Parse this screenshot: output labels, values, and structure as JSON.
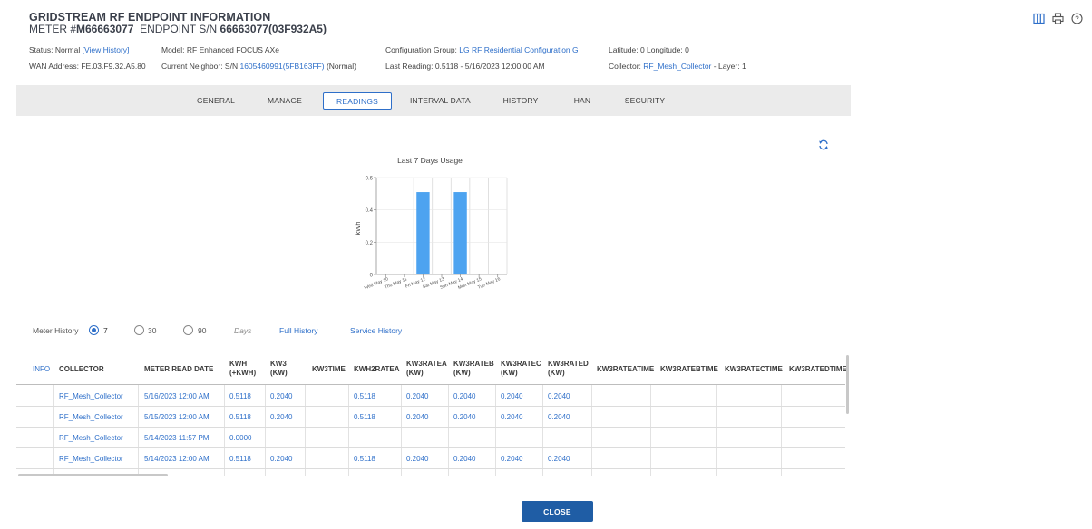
{
  "header": {
    "title": "GRIDSTREAM RF ENDPOINT INFORMATION",
    "meter_prefix": "METER #",
    "meter_number": "M66663077",
    "endpoint_prefix": "ENDPOINT S/N",
    "endpoint_sn": "66663077(03F932A5)"
  },
  "icons": [
    "columns-icon",
    "print-icon",
    "help-icon"
  ],
  "info": {
    "status_label": "Status: Normal",
    "view_history": "[View History]",
    "wan": "WAN Address: FE.03.F9.32.A5.80",
    "model": "Model: RF Enhanced FOCUS AXe",
    "neighbor_label": "Current Neighbor: S/N",
    "neighbor_link": "1605460991(5FB163FF)",
    "neighbor_status": "(Normal)",
    "config_label": "Configuration Group:",
    "config_link": "LG RF Residential Configuration G",
    "last_reading": "Last Reading: 0.5118 - 5/16/2023 12:00:00 AM",
    "latlon": "Latitude: 0 Longitude: 0",
    "collector_label": "Collector:",
    "collector_link": "RF_Mesh_Collector",
    "collector_layer": "- Layer: 1"
  },
  "tabs": [
    {
      "label": "GENERAL",
      "active": false
    },
    {
      "label": "MANAGE",
      "active": false
    },
    {
      "label": "READINGS",
      "active": true
    },
    {
      "label": "INTERVAL DATA",
      "active": false
    },
    {
      "label": "HISTORY",
      "active": false
    },
    {
      "label": "HAN",
      "active": false
    },
    {
      "label": "SECURITY",
      "active": false
    }
  ],
  "chart_data": {
    "type": "bar",
    "title": "Last 7 Days Usage",
    "ylabel": "kWh",
    "xlabel": "",
    "categories": [
      "Wed May 10",
      "Thu May 11",
      "Fri May 12",
      "Sat May 13",
      "Sun May 14",
      "Mon May 15",
      "Tue May 16"
    ],
    "values": [
      0,
      0,
      0.51,
      0,
      0.51,
      0,
      0
    ],
    "ylim": [
      0,
      0.6
    ],
    "yticks": [
      "0",
      "0.2",
      "0.4",
      "0.6"
    ],
    "grid": true,
    "bar_color": "#4da3f0"
  },
  "history": {
    "label": "Meter History",
    "options": [
      "7",
      "30",
      "90"
    ],
    "selected": "7",
    "days": "Days",
    "full_history": "Full History",
    "service_history": "Service History"
  },
  "table": {
    "info_header": "INFO",
    "columns": [
      [
        "COLLECTOR"
      ],
      [
        "METER READ DATE"
      ],
      [
        "KWH",
        "(+KWH)"
      ],
      [
        "KW3",
        "(KW)"
      ],
      [
        "KW3TIME"
      ],
      [
        "KWH2RATEA"
      ],
      [
        "KW3RATEA",
        "(KW)"
      ],
      [
        "KW3RATEB",
        "(KW)"
      ],
      [
        "KW3RATEC",
        "(KW)"
      ],
      [
        "KW3RATED",
        "(KW)"
      ],
      [
        "KW3RATEATIME"
      ],
      [
        "KW3RATEBTIME"
      ],
      [
        "KW3RATECTIME"
      ],
      [
        "KW3RATEDTIME"
      ]
    ],
    "rows": [
      [
        "RF_Mesh_Collector",
        "5/16/2023 12:00 AM",
        "0.5118",
        "0.2040",
        "",
        "0.5118",
        "0.2040",
        "0.2040",
        "0.2040",
        "0.2040",
        "",
        "",
        "",
        ""
      ],
      [
        "RF_Mesh_Collector",
        "5/15/2023 12:00 AM",
        "0.5118",
        "0.2040",
        "",
        "0.5118",
        "0.2040",
        "0.2040",
        "0.2040",
        "0.2040",
        "",
        "",
        "",
        ""
      ],
      [
        "RF_Mesh_Collector",
        "5/14/2023 11:57 PM",
        "0.0000",
        "",
        "",
        "",
        "",
        "",
        "",
        "",
        "",
        "",
        "",
        ""
      ],
      [
        "RF_Mesh_Collector",
        "5/14/2023 12:00 AM",
        "0.5118",
        "0.2040",
        "",
        "0.5118",
        "0.2040",
        "0.2040",
        "0.2040",
        "0.2040",
        "",
        "",
        "",
        ""
      ]
    ]
  },
  "close_label": "CLOSE"
}
